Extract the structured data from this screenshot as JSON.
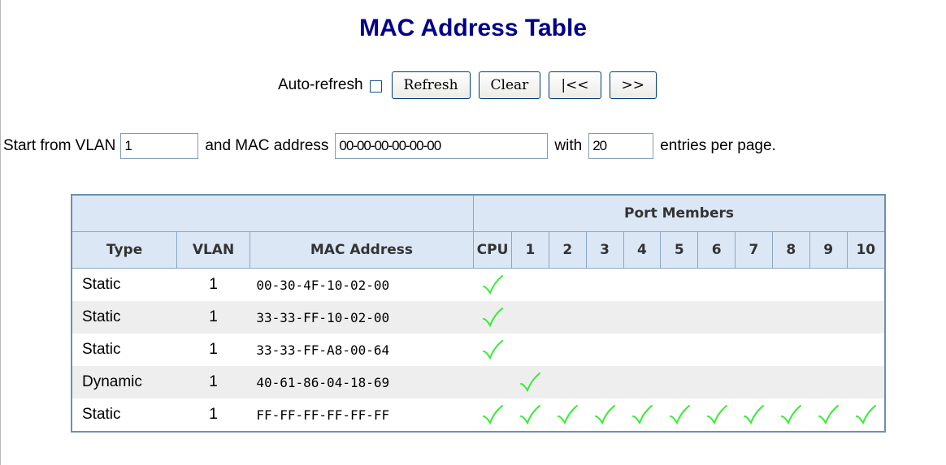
{
  "page": {
    "title": "MAC Address Table"
  },
  "controls": {
    "auto_refresh_label": "Auto-refresh",
    "auto_refresh_checked": false,
    "refresh_label": "Refresh",
    "clear_label": "Clear",
    "first_page_label": "|<<",
    "next_page_label": ">>"
  },
  "filters": {
    "start_from_vlan_label": "Start from VLAN",
    "vlan_value": "1",
    "and_mac_label": "and MAC address",
    "mac_value": "00-00-00-00-00-00",
    "with_label": "with",
    "entries_value": "20",
    "entries_suffix": "entries per page."
  },
  "table": {
    "group_header": "Port Members",
    "columns": [
      "Type",
      "VLAN",
      "MAC Address"
    ],
    "ports": [
      "CPU",
      "1",
      "2",
      "3",
      "4",
      "5",
      "6",
      "7",
      "8",
      "9",
      "10"
    ],
    "rows": [
      {
        "type": "Static",
        "vlan": "1",
        "mac": "00-30-4F-10-02-00",
        "members": [
          true,
          false,
          false,
          false,
          false,
          false,
          false,
          false,
          false,
          false,
          false
        ]
      },
      {
        "type": "Static",
        "vlan": "1",
        "mac": "33-33-FF-10-02-00",
        "members": [
          true,
          false,
          false,
          false,
          false,
          false,
          false,
          false,
          false,
          false,
          false
        ]
      },
      {
        "type": "Static",
        "vlan": "1",
        "mac": "33-33-FF-A8-00-64",
        "members": [
          true,
          false,
          false,
          false,
          false,
          false,
          false,
          false,
          false,
          false,
          false
        ]
      },
      {
        "type": "Dynamic",
        "vlan": "1",
        "mac": "40-61-86-04-18-69",
        "members": [
          false,
          true,
          false,
          false,
          false,
          false,
          false,
          false,
          false,
          false,
          false
        ]
      },
      {
        "type": "Static",
        "vlan": "1",
        "mac": "FF-FF-FF-FF-FF-FF",
        "members": [
          true,
          true,
          true,
          true,
          true,
          true,
          true,
          true,
          true,
          true,
          true
        ]
      }
    ]
  },
  "colors": {
    "title": "#00008b",
    "header_bg": "#dbe7f5",
    "check": "#33ee33",
    "row_alt": "#eeeeee"
  },
  "icons": {
    "member": "check-icon"
  }
}
